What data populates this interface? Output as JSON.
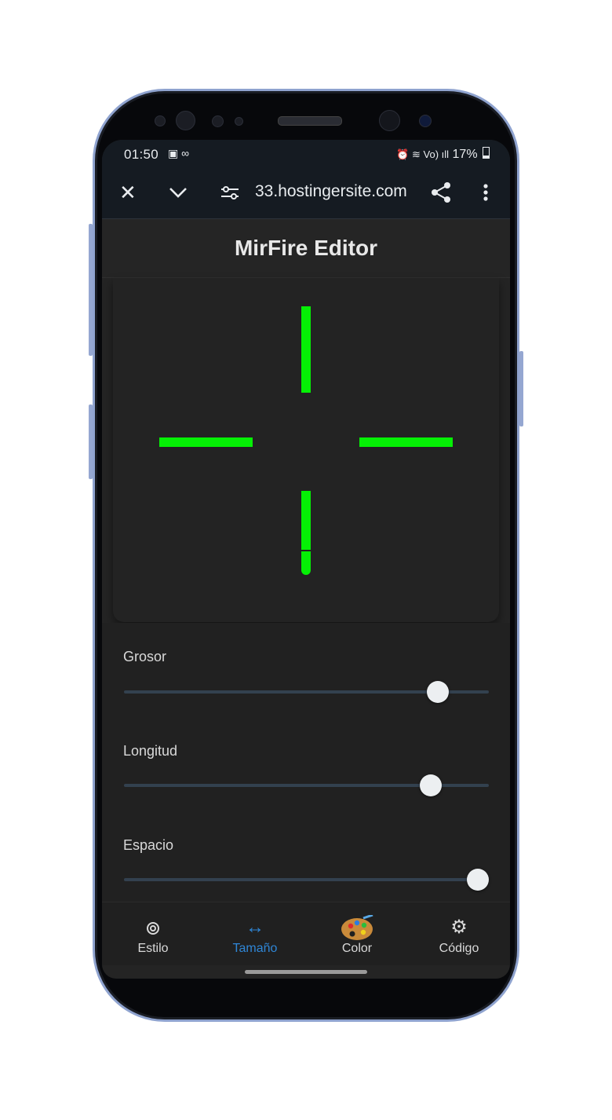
{
  "status_bar": {
    "time": "01:50",
    "left_icons": "▣ ∞",
    "right_icons": "⏰ ≋ Vo) ıll",
    "battery": "17%"
  },
  "browser_bar": {
    "close_icon": "close-icon",
    "chevron_icon": "chevron-down-icon",
    "tune_icon": "tune-icon",
    "url": "33.hostingersite.com",
    "share_icon": "share-icon",
    "menu_icon": "more-vert-icon"
  },
  "app": {
    "title": "MirFire Editor"
  },
  "crosshair": {
    "color": "#05f005"
  },
  "controls": [
    {
      "label": "Grosor",
      "value_fraction": 0.86
    },
    {
      "label": "Longitud",
      "value_fraction": 0.84
    },
    {
      "label": "Espacio",
      "value_fraction": 0.97
    }
  ],
  "bottom_nav": [
    {
      "label": "Estilo",
      "icon": "target-icon",
      "active": false
    },
    {
      "label": "Tamaño",
      "icon": "resize-arrows-icon",
      "active": true
    },
    {
      "label": "Color",
      "icon": "palette-icon",
      "active": false
    },
    {
      "label": "Código",
      "icon": "gear-icon",
      "active": false
    }
  ],
  "colors": {
    "accent": "#2f86d6",
    "crosshair": "#05f005",
    "background": "#242424"
  }
}
